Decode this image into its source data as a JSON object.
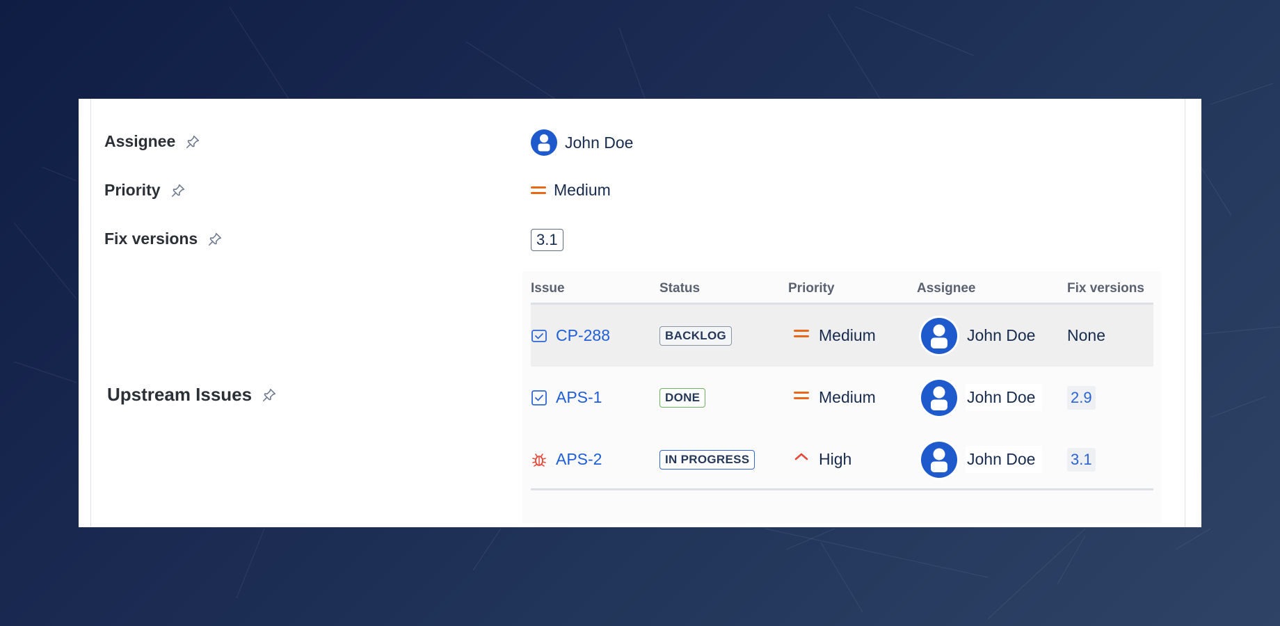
{
  "fields": {
    "assignee": {
      "label": "Assignee",
      "value": "John Doe",
      "icon": "avatar-icon"
    },
    "priority": {
      "label": "Priority",
      "value": "Medium",
      "icon": "priority-medium-icon",
      "color": "#e8681a"
    },
    "fix_versions": {
      "label": "Fix versions",
      "value": "3.1"
    }
  },
  "upstream": {
    "label": "Upstream Issues",
    "columns": [
      "Issue",
      "Status",
      "Priority",
      "Assignee",
      "Fix versions"
    ],
    "rows": [
      {
        "key": "CP-288",
        "type": "task",
        "status": "BACKLOG",
        "priority": "Medium",
        "assignee": "John Doe",
        "fix_version": "None"
      },
      {
        "key": "APS-1",
        "type": "task",
        "status": "DONE",
        "priority": "Medium",
        "assignee": "John Doe",
        "fix_version": "2.9"
      },
      {
        "key": "APS-2",
        "type": "bug",
        "status": "IN PROGRESS",
        "priority": "High",
        "assignee": "John Doe",
        "fix_version": "3.1"
      }
    ]
  },
  "colors": {
    "link": "#1f5ed6",
    "avatar": "#1f5acc",
    "priority": "#e8681a",
    "bug": "#e5493a"
  }
}
